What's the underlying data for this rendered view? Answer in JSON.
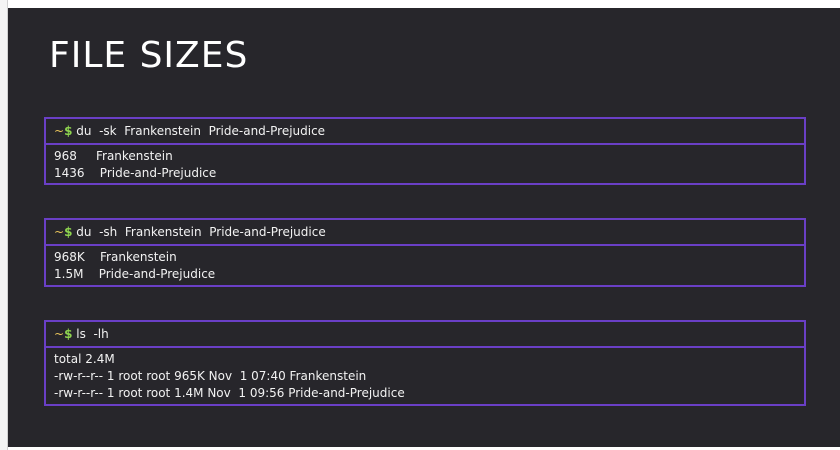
{
  "slide": {
    "title": "FILE SIZES"
  },
  "prompt": {
    "tilde": "~",
    "dollar": "$"
  },
  "terminals": [
    {
      "command": " du  -sk  Frankenstein  Pride-and-Prejudice",
      "output": [
        "968     Frankenstein",
        "1436    Pride-and-Prejudice"
      ]
    },
    {
      "command": " du  -sh  Frankenstein  Pride-and-Prejudice",
      "output": [
        "968K    Frankenstein",
        "1.5M    Pride-and-Prejudice"
      ]
    },
    {
      "command": " ls  -lh",
      "output": [
        "total 2.4M",
        "-rw-r--r-- 1 root root 965K Nov  1 07:40 Frankenstein",
        "-rw-r--r-- 1 root root 1.4M Nov  1 09:56 Pride-and-Prejudice"
      ]
    }
  ],
  "colors": {
    "background": "#27262b",
    "border": "#6a3fc6",
    "prompt_tilde": "#e8c35a",
    "prompt_dollar": "#8ed34f"
  }
}
